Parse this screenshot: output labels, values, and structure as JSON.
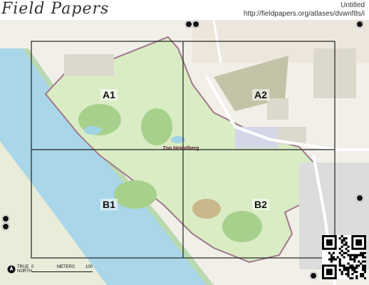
{
  "header": {
    "logo": "Field Papers",
    "title": "Untitled",
    "url": "http://fieldpapers.org/atlases/dvwnf8s/i"
  },
  "grid": {
    "cells": [
      "A1",
      "A2",
      "B1",
      "B2"
    ]
  },
  "map": {
    "zoo_label": "Zoo Heidelberg",
    "colors": {
      "river": "#a9d6e8",
      "land": "#f1efe8",
      "park": "#c8e0a8",
      "zoo_boundary": "#a07a8a",
      "grid_line": "#222222",
      "building": "#ddd8cc"
    }
  },
  "scale": {
    "north_label": "TRUE NORTH",
    "zero": "0",
    "unit": "METERS",
    "max": "100"
  },
  "icons": [
    "north-arrow-icon",
    "qr-code",
    "map-marker-icon"
  ]
}
